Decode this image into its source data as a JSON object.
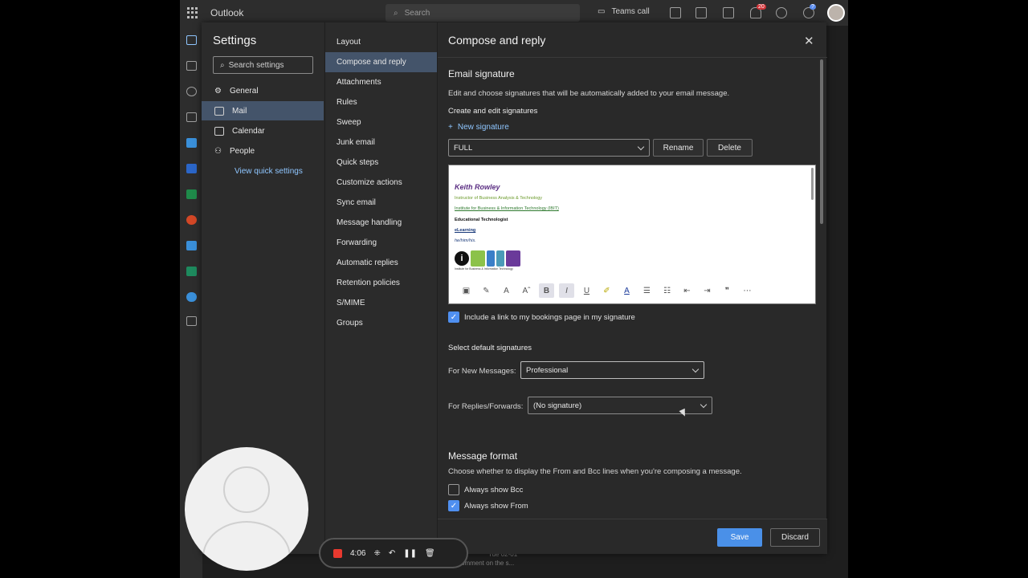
{
  "topbar": {
    "app_name": "Outlook",
    "search_placeholder": "Search",
    "teams_call": "Teams call",
    "notification_count": "20",
    "help_badge": "?"
  },
  "settings": {
    "title": "Settings",
    "search_placeholder": "Search settings",
    "categories": [
      {
        "label": "General",
        "icon": "gear-icon"
      },
      {
        "label": "Mail",
        "icon": "mail-icon"
      },
      {
        "label": "Calendar",
        "icon": "calendar-icon"
      },
      {
        "label": "People",
        "icon": "people-icon"
      }
    ],
    "quick_settings": "View quick settings",
    "subnav": [
      "Layout",
      "Compose and reply",
      "Attachments",
      "Rules",
      "Sweep",
      "Junk email",
      "Quick steps",
      "Customize actions",
      "Sync email",
      "Message handling",
      "Forwarding",
      "Automatic replies",
      "Retention policies",
      "S/MIME",
      "Groups"
    ]
  },
  "pane": {
    "title": "Compose and reply",
    "email_signature": {
      "heading": "Email signature",
      "description": "Edit and choose signatures that will be automatically added to your email message.",
      "create_label": "Create and edit signatures",
      "new_signature": "New signature",
      "selected_signature": "FULL",
      "rename": "Rename",
      "delete": "Delete"
    },
    "signature_content": {
      "name": "Keith Rowley",
      "line1": "Instructor of Business Analysis & Technology",
      "line2": "Institute for Business & Information Technology (IBIT)",
      "line3": "Educational Technologist",
      "line4": "eLearning",
      "line5": "he/him/his.",
      "logo_letter": "i",
      "logo_caption": "Institute for Business & Information Technology"
    },
    "bookings_link": "Include a link to my bookings page in my signature",
    "defaults": {
      "heading": "Select default signatures",
      "new_messages_label": "For New Messages:",
      "new_messages_value": "Professional",
      "replies_label": "For Replies/Forwards:",
      "replies_value": "(No signature)"
    },
    "message_format": {
      "heading": "Message format",
      "description": "Choose whether to display the From and Bcc lines when you're composing a message.",
      "bcc": "Always show Bcc",
      "from": "Always show From"
    },
    "save": "Save",
    "discard": "Discard"
  },
  "recorder": {
    "time": "4:06"
  },
  "background_ghost": {
    "date": "Tue 02-01",
    "snippet": "comment on the s..."
  }
}
